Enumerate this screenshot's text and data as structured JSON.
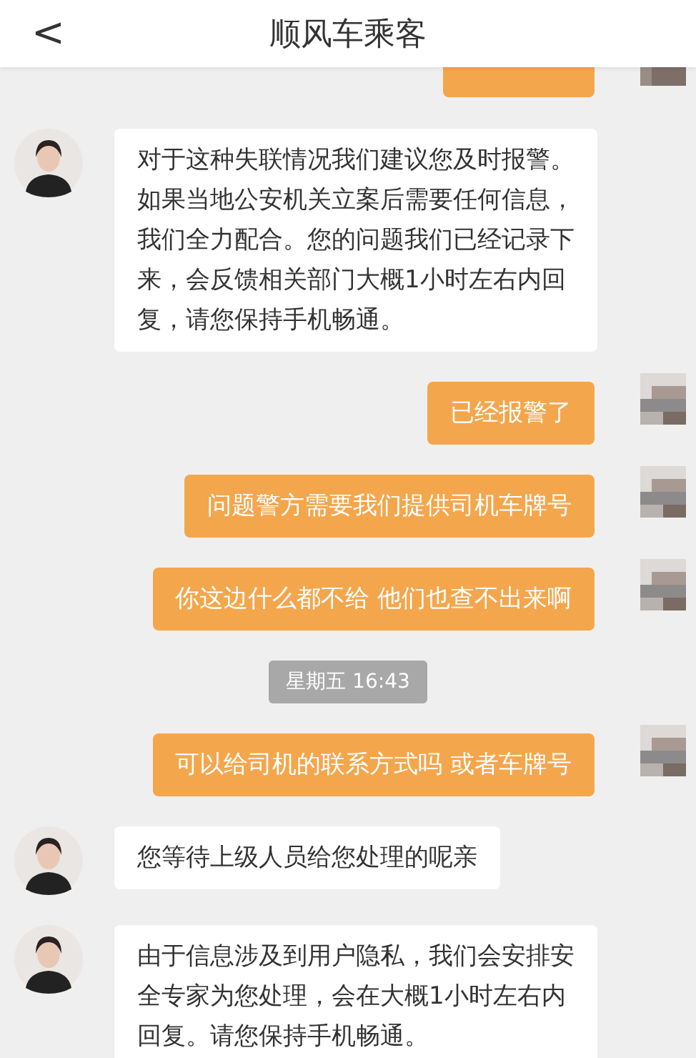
{
  "header": {
    "back": "<",
    "title": "顺风车乘客"
  },
  "messages": [
    {
      "kind": "clipped"
    },
    {
      "kind": "incoming",
      "text": "对于这种失联情况我们建议您及时报警。如果当地公安机关立案后需要任何信息，我们全力配合。您的问题我们已经记录下来，会反馈相关部门大概1小时左右内回复，请您保持手机畅通。"
    },
    {
      "kind": "outgoing",
      "text": "已经报警了"
    },
    {
      "kind": "outgoing",
      "text": "问题警方需要我们提供司机车牌号"
    },
    {
      "kind": "outgoing",
      "text": "你这边什么都不给 他们也查不出来啊"
    },
    {
      "kind": "time",
      "text": "星期五 16:43"
    },
    {
      "kind": "outgoing",
      "text": "可以给司机的联系方式吗 或者车牌号"
    },
    {
      "kind": "incoming",
      "text": "您等待上级人员给您处理的呢亲"
    },
    {
      "kind": "incoming",
      "text": "由于信息涉及到用户隐私，我们会安排安全专家为您处理，会在大概1小时左右内回复。请您保持手机畅通。"
    }
  ]
}
